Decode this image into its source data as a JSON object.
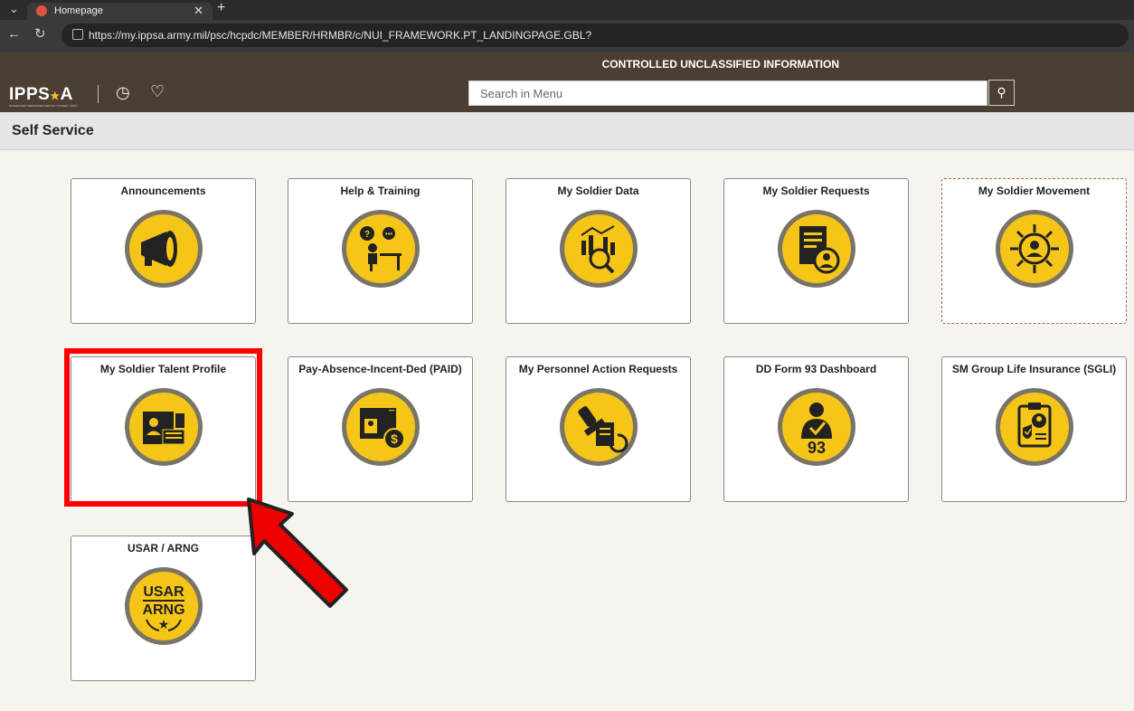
{
  "browser": {
    "tab_title": "Homepage",
    "url": "https://my.ippsa.army.mil/psc/hcpdc/MEMBER/HRMBR/c/NUI_FRAMEWORK.PT_LANDINGPAGE.GBL?"
  },
  "header": {
    "banner": "CONTROLLED UNCLASSIFIED INFORMATION",
    "logo_main": "IPPS",
    "logo_end": "A",
    "logo_tagline": "INTEGRATED PERSONNEL AND PAY SYSTEM - ARMY",
    "search_placeholder": "Search in Menu"
  },
  "page": {
    "title": "Self Service"
  },
  "tiles": [
    {
      "title": "Announcements",
      "icon": "megaphone-icon"
    },
    {
      "title": "Help & Training",
      "icon": "help-training-icon"
    },
    {
      "title": "My Soldier Data",
      "icon": "data-analysis-icon"
    },
    {
      "title": "My Soldier Requests",
      "icon": "requests-document-icon"
    },
    {
      "title": "My Soldier Movement",
      "icon": "movement-icon"
    },
    {
      "title": "My Soldier Talent Profile",
      "icon": "id-card-icon"
    },
    {
      "title": "Pay-Absence-Incent-Ded (PAID)",
      "icon": "pay-dollar-icon"
    },
    {
      "title": "My Personnel Action Requests",
      "icon": "stamp-action-icon"
    },
    {
      "title": "DD Form 93 Dashboard",
      "icon": "dd93-soldier-icon",
      "icon_text": "93"
    },
    {
      "title": "SM Group Life Insurance (SGLI)",
      "icon": "insurance-clipboard-icon"
    },
    {
      "title": "USAR / ARNG",
      "icon": "usar-arng-badge-icon",
      "icon_text_1": "USAR",
      "icon_text_2": "ARNG"
    }
  ],
  "colors": {
    "icon_yellow": "#f5c518",
    "icon_ring": "#7a7468",
    "header_brown": "#4a3f32",
    "highlight_red": "#ff0000"
  }
}
